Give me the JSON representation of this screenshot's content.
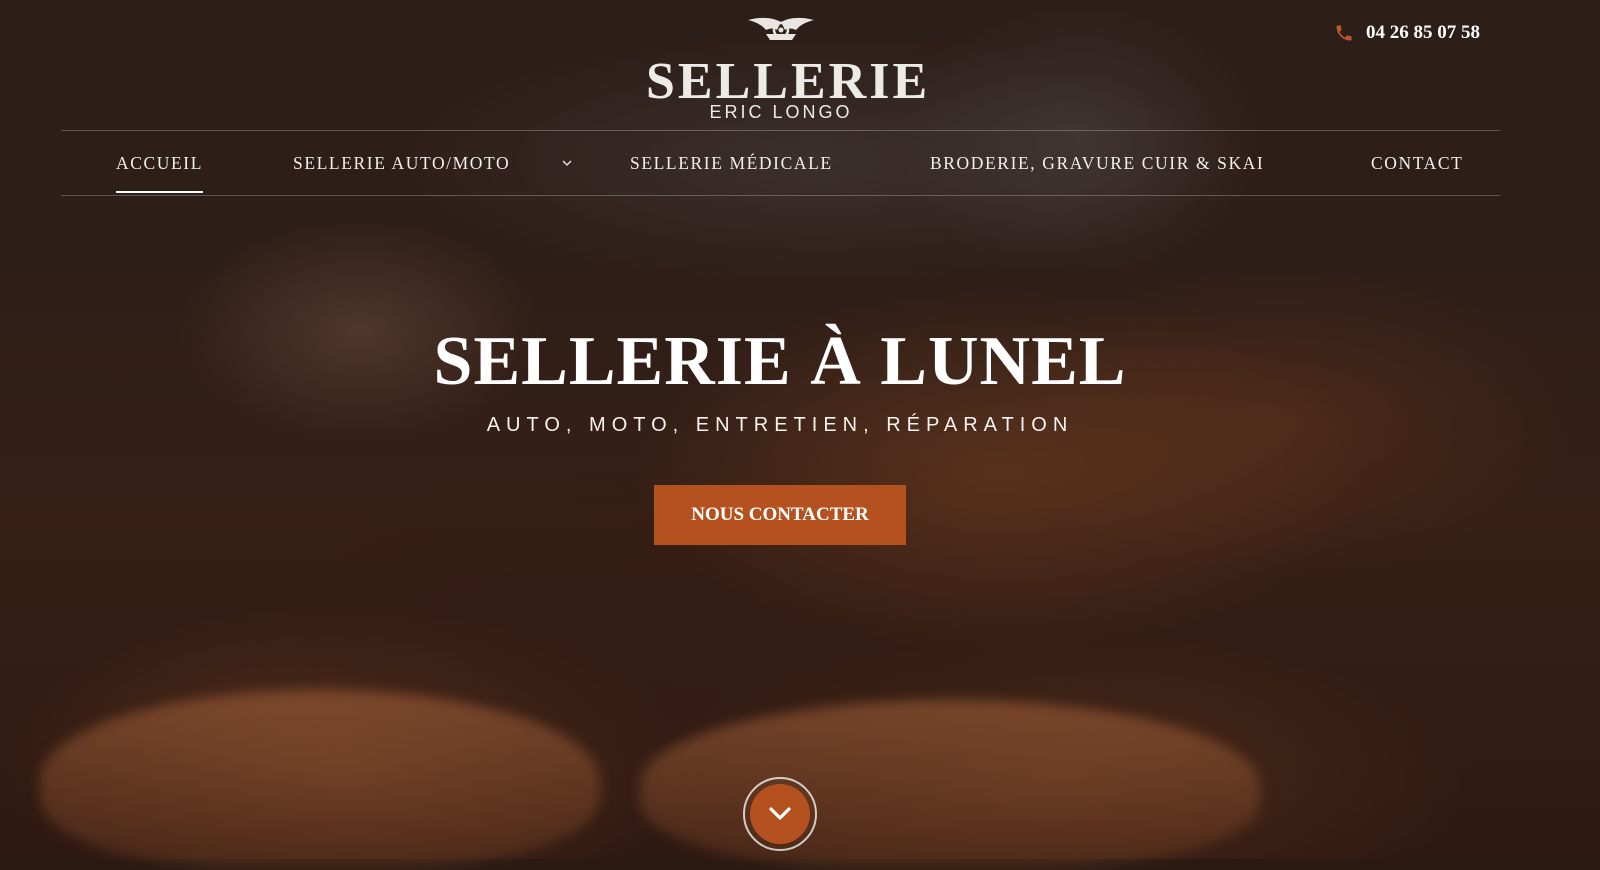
{
  "header": {
    "logo": {
      "title": "SELLERIE",
      "subtitle": "ERIC LONGO"
    },
    "phone": {
      "icon": "phone-icon",
      "number": "04 26 85 07 58"
    }
  },
  "nav": {
    "items": [
      {
        "label": "ACCUEIL",
        "active": true
      },
      {
        "label": "SELLERIE AUTO/MOTO",
        "has_submenu": true
      },
      {
        "label": "SELLERIE MÉDICALE"
      },
      {
        "label": "BRODERIE, GRAVURE CUIR & SKAI"
      },
      {
        "label": "CONTACT"
      }
    ]
  },
  "hero": {
    "title": "SELLERIE À LUNEL",
    "subtitle": "AUTO, MOTO, ENTRETIEN, RÉPARATION",
    "cta_label": "NOUS CONTACTER",
    "scroll_icon": "chevron-down-icon"
  },
  "colors": {
    "accent": "#b4511f",
    "text": "#ffffff"
  }
}
